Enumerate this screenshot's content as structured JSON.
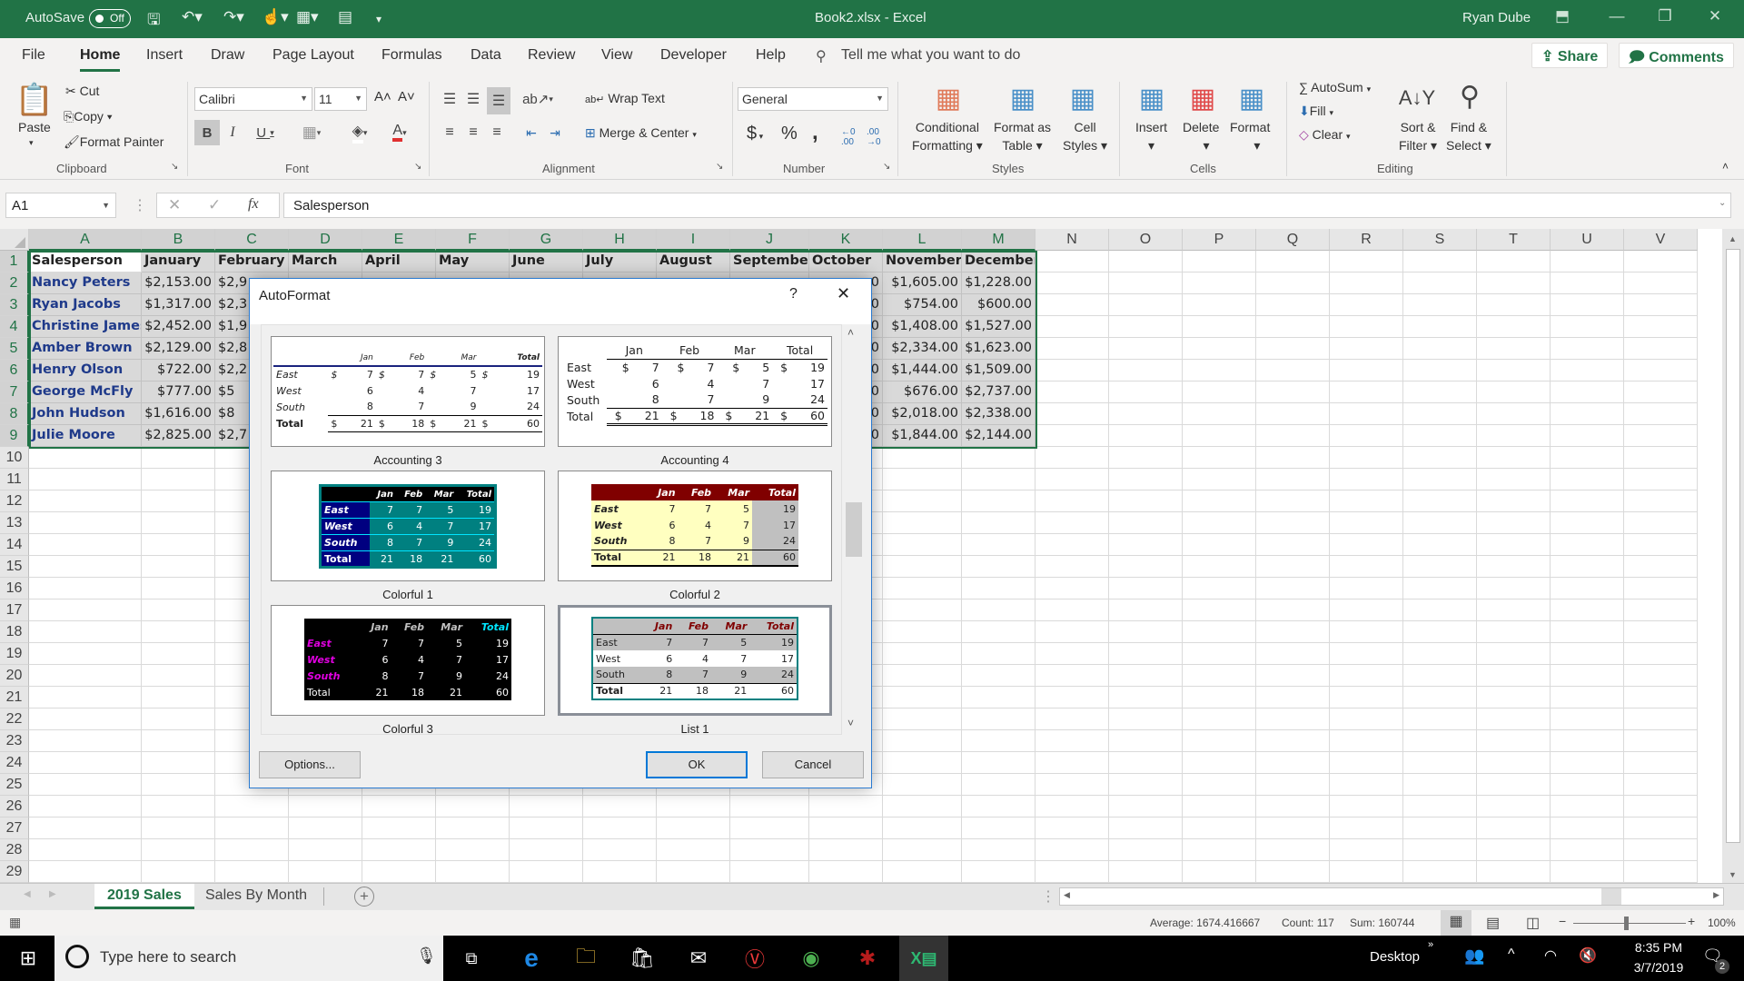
{
  "titlebar": {
    "autosave_label": "AutoSave",
    "autosave_state": "Off",
    "doc_title": "Book2.xlsx  -  Excel",
    "user": "Ryan Dube"
  },
  "tabs": [
    "File",
    "Home",
    "Insert",
    "Draw",
    "Page Layout",
    "Formulas",
    "Data",
    "Review",
    "View",
    "Developer",
    "Help"
  ],
  "tell_me": "Tell me what you want to do",
  "share_label": "Share",
  "comments_label": "Comments",
  "ribbon": {
    "clipboard": {
      "paste": "Paste",
      "cut": "Cut",
      "copy": "Copy",
      "format_painter": "Format Painter",
      "group": "Clipboard"
    },
    "font": {
      "name": "Calibri",
      "size": "11",
      "group": "Font",
      "bold": "B",
      "italic": "I",
      "underline": "U"
    },
    "alignment": {
      "wrap": "Wrap Text",
      "merge": "Merge & Center",
      "group": "Alignment"
    },
    "number": {
      "format": "General",
      "group": "Number",
      "currency": "$",
      "percent": "%",
      "comma": ","
    },
    "styles": {
      "conditional": "Conditional",
      "conditional2": "Formatting",
      "format_table": "Format as",
      "format_table2": "Table",
      "cell_styles": "Cell",
      "cell_styles2": "Styles",
      "group": "Styles"
    },
    "cells": {
      "insert": "Insert",
      "delete": "Delete",
      "format": "Format",
      "group": "Cells"
    },
    "editing": {
      "autosum": "AutoSum",
      "fill": "Fill",
      "clear": "Clear",
      "sort": "Sort &",
      "sort2": "Filter",
      "find": "Find &",
      "find2": "Select",
      "group": "Editing"
    }
  },
  "formula_bar": {
    "name_box": "A1",
    "fx": "fx",
    "content": "Salesperson"
  },
  "columns": [
    "A",
    "B",
    "C",
    "D",
    "E",
    "F",
    "G",
    "H",
    "I",
    "J",
    "K",
    "L",
    "M",
    "N",
    "O",
    "P",
    "Q",
    "R",
    "S",
    "T",
    "U",
    "V"
  ],
  "rows": [
    "1",
    "2",
    "3",
    "4",
    "5",
    "6",
    "7",
    "8",
    "9",
    "10",
    "11",
    "12",
    "13",
    "14",
    "15",
    "16",
    "17",
    "18",
    "19",
    "20",
    "21",
    "22",
    "23",
    "24",
    "25",
    "26",
    "27",
    "28",
    "29"
  ],
  "sheet": {
    "headers": [
      "Salesperson",
      "January",
      "February",
      "March",
      "April",
      "May",
      "June",
      "July",
      "August",
      "September",
      "October",
      "November",
      "December"
    ],
    "names": [
      "Nancy Peters",
      "Ryan Jacobs",
      "Christine James",
      "Amber Brown",
      "Henry Olson",
      "George McFly",
      "John Hudson",
      "Julie Moore"
    ],
    "january": [
      "$2,153.00",
      "$1,317.00",
      "$2,452.00",
      "$2,129.00",
      "$722.00",
      "$777.00",
      "$1,616.00",
      "$2,825.00"
    ],
    "february_visible": [
      "$2,9",
      "$2,3",
      "$1,9",
      "$2,8",
      "$2,2",
      "$5",
      "$8",
      "$2,7"
    ],
    "october_visible": [
      "0",
      "0",
      "0",
      "0",
      "0",
      "0",
      "0",
      "0"
    ],
    "november": [
      "$1,605.00",
      "$754.00",
      "$1,408.00",
      "$2,334.00",
      "$1,444.00",
      "$676.00",
      "$2,018.00",
      "$1,844.00"
    ],
    "december": [
      "$1,228.00",
      "$600.00",
      "$1,527.00",
      "$1,623.00",
      "$1,509.00",
      "$2,737.00",
      "$2,338.00",
      "$2,144.00"
    ]
  },
  "dialog": {
    "title": "AutoFormat",
    "help": "?",
    "close": "✕",
    "preview": {
      "months": [
        "Jan",
        "Feb",
        "Mar",
        "Total"
      ],
      "regions": [
        "East",
        "West",
        "South",
        "Total"
      ],
      "values": [
        [
          "7",
          "7",
          "5",
          "19"
        ],
        [
          "6",
          "4",
          "7",
          "17"
        ],
        [
          "8",
          "7",
          "9",
          "24"
        ],
        [
          "21",
          "18",
          "21",
          "60"
        ]
      ],
      "currency": "$"
    },
    "formats": [
      {
        "name": "Accounting 3",
        "selected": false
      },
      {
        "name": "Accounting 4",
        "selected": false
      },
      {
        "name": "Colorful 1",
        "selected": false
      },
      {
        "name": "Colorful 2",
        "selected": false
      },
      {
        "name": "Colorful 3",
        "selected": false
      },
      {
        "name": "List 1",
        "selected": true
      }
    ],
    "options_label": "Options...",
    "ok_label": "OK",
    "cancel_label": "Cancel"
  },
  "sheet_tabs": [
    "2019 Sales",
    "Sales By Month"
  ],
  "active_sheet": "2019 Sales",
  "status": {
    "average": "Average: 1674.416667",
    "count": "Count: 117",
    "sum": "Sum: 160744",
    "zoom": "100%"
  },
  "taskbar": {
    "search_placeholder": "Type here to search",
    "desktop": "Desktop",
    "time": "8:35 PM",
    "date": "3/7/2019",
    "notifications": "2"
  },
  "colors": {
    "excel_green": "#217346",
    "selection": "#d9d9d9",
    "name_blue": "#1f3a8a",
    "dialog_accent": "#0078d7"
  }
}
